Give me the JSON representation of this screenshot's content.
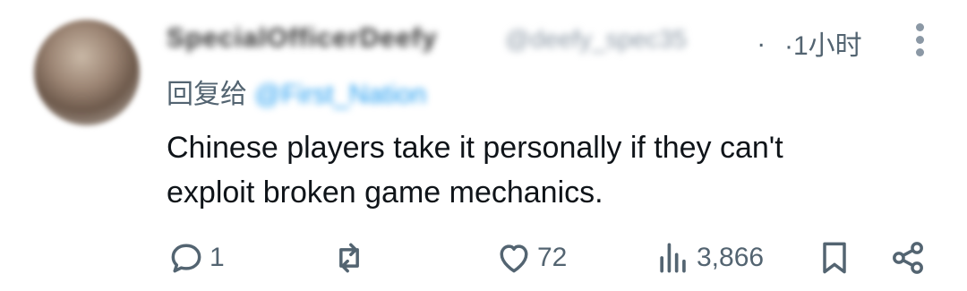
{
  "tweet": {
    "display_name": "SpecialOfficerDeefy",
    "handle": "@deefy_spec35",
    "ellipsis": ".",
    "time": "·1小时",
    "reply_prefix": "回复给",
    "reply_to": "@First_Nation",
    "text_line1": "Chinese players take it personally if they can't",
    "text_line2": "exploit broken game mechanics."
  },
  "actions": {
    "replies": "1",
    "retweets": "",
    "likes": "72",
    "views": "3,866"
  },
  "icons": {
    "reply": "reply-icon",
    "retweet": "retweet-icon",
    "like": "heart-icon",
    "views": "views-icon",
    "bookmark": "bookmark-icon",
    "share": "share-icon",
    "more": "more-vertical-icon"
  },
  "colors": {
    "text": "#0f1419",
    "muted": "#536471",
    "link": "#1d9bf0"
  }
}
